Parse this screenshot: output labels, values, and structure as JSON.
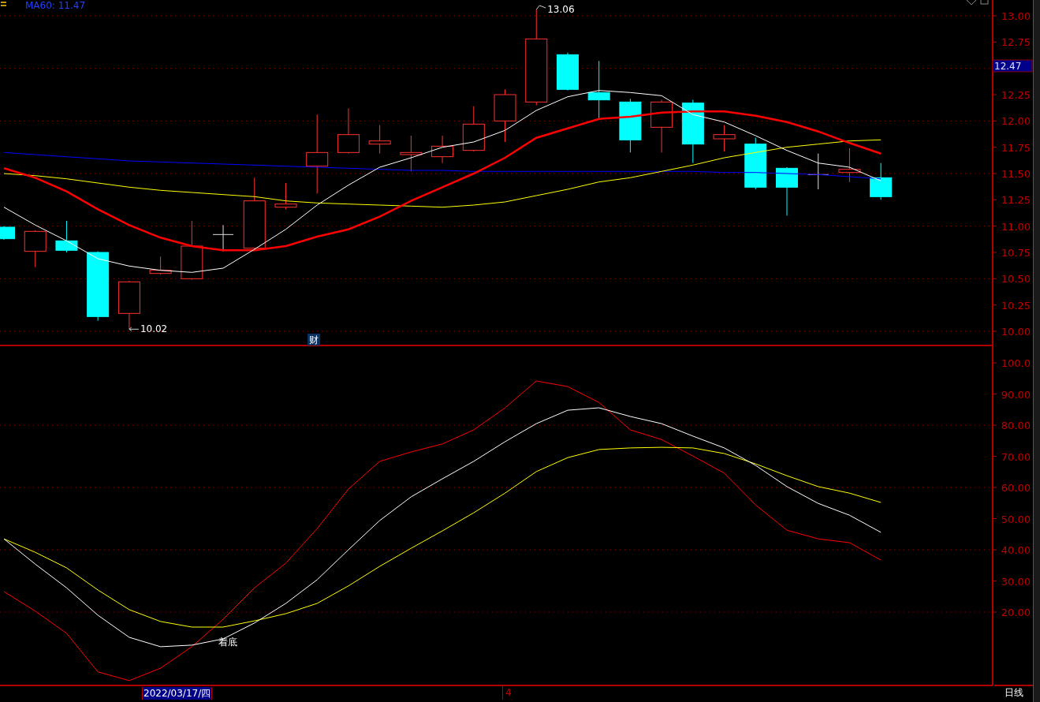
{
  "header": {
    "indicator": "MA60: 11.47"
  },
  "price_panel": {
    "current_price": "12.47",
    "event_marker": "财",
    "chart_data": {
      "type": "line",
      "grid": true,
      "ylim": [
        9.865,
        13.15
      ],
      "yticks": [
        {
          "value": 13,
          "label": "13.00"
        },
        {
          "value": 12.75,
          "label": "12.75"
        },
        {
          "value": 12.25,
          "label": "12.25"
        },
        {
          "value": 12,
          "label": "12.00"
        },
        {
          "value": 11.75,
          "label": "11.75"
        },
        {
          "value": 11.5,
          "label": "11.50"
        },
        {
          "value": 11.25,
          "label": "11.25"
        },
        {
          "value": 11,
          "label": "11.00"
        },
        {
          "value": 10.75,
          "label": "10.75"
        },
        {
          "value": 10.5,
          "label": "10.50"
        },
        {
          "value": 10.25,
          "label": "10.25"
        },
        {
          "value": 10,
          "label": "10.00"
        }
      ],
      "series": [
        {
          "color": "#0000ff",
          "values": [
            11.7,
            11.68,
            11.66,
            11.64,
            11.62,
            11.61,
            11.6,
            11.59,
            11.58,
            11.57,
            11.56,
            11.55,
            11.54,
            11.53,
            11.53,
            11.52,
            11.52,
            11.52,
            11.52,
            11.52,
            11.52,
            11.52,
            11.52,
            11.51,
            11.51,
            11.5,
            11.49,
            11.47,
            11.45
          ]
        },
        {
          "color": "#ffff00",
          "values": [
            11.5,
            11.48,
            11.45,
            11.41,
            11.37,
            11.34,
            11.32,
            11.3,
            11.28,
            11.24,
            11.22,
            11.21,
            11.2,
            11.19,
            11.18,
            11.2,
            11.23,
            11.29,
            11.35,
            11.42,
            11.46,
            11.52,
            11.58,
            11.65,
            11.7,
            11.75,
            11.78,
            11.81,
            11.82
          ]
        },
        {
          "color": "#ff0000",
          "values": [
            11.55,
            11.46,
            11.33,
            11.16,
            11.01,
            10.89,
            10.81,
            10.77,
            10.77,
            10.81,
            10.9,
            10.97,
            11.09,
            11.24,
            11.37,
            11.5,
            11.65,
            11.84,
            11.93,
            12.02,
            12.04,
            12.08,
            12.09,
            12.09,
            12.05,
            11.99,
            11.9,
            11.79,
            11.69
          ]
        },
        {
          "color": "#ffffff",
          "values": [
            11.18,
            11.01,
            10.86,
            10.69,
            10.62,
            10.58,
            10.56,
            10.6,
            10.78,
            10.97,
            11.2,
            11.39,
            11.56,
            11.65,
            11.75,
            11.8,
            11.91,
            12.1,
            12.23,
            12.29,
            12.27,
            12.24,
            12.06,
            11.99,
            11.86,
            11.72,
            11.6,
            11.56,
            11.43
          ]
        }
      ],
      "annotations": [
        "13.06",
        "10.02"
      ]
    }
  },
  "indicator_panel": {
    "signal_label": "着底",
    "chart_data": {
      "type": "line",
      "grid": true,
      "ylim": [
        -3.8,
        105.6
      ],
      "yticks": [
        {
          "value": 100,
          "label": "100.0"
        },
        {
          "value": 90,
          "label": "90.00"
        },
        {
          "value": 80,
          "label": "80.00"
        },
        {
          "value": 70,
          "label": "70.00"
        },
        {
          "value": 60,
          "label": "60.00"
        },
        {
          "value": 50,
          "label": "50.00"
        },
        {
          "value": 40,
          "label": "40.00"
        },
        {
          "value": 30,
          "label": "30.00"
        },
        {
          "value": 20,
          "label": "20.00"
        }
      ],
      "series": [
        {
          "color": "#ff0000",
          "values": [
            26.6,
            20.3,
            13.2,
            0.8,
            -2,
            2,
            8.9,
            17.7,
            27.8,
            35.7,
            46.8,
            59.5,
            68.4,
            71.4,
            74,
            78.5,
            85.6,
            94.2,
            92.4,
            87.3,
            78.5,
            75.4,
            70.1,
            64.6,
            54.4,
            46.3,
            43.5,
            42.3,
            36.7
          ]
        },
        {
          "color": "#ffff00",
          "values": [
            43.5,
            39.2,
            34.2,
            27.1,
            20.8,
            17,
            15.2,
            15.2,
            17.2,
            19.5,
            22.8,
            28.4,
            34.7,
            40.5,
            46.1,
            51.9,
            58.2,
            65.1,
            69.6,
            72.2,
            72.7,
            72.9,
            72.7,
            70.9,
            67.6,
            63.8,
            60.3,
            58.2,
            55.2
          ]
        },
        {
          "color": "#ffffff",
          "values": [
            43.5,
            35.4,
            27.8,
            19,
            11.9,
            8.9,
            9.4,
            11.4,
            16.5,
            22.8,
            30.4,
            40,
            49.4,
            57,
            62.8,
            68.4,
            74.7,
            80.5,
            84.8,
            85.6,
            82.8,
            80.5,
            76.5,
            72.7,
            67.1,
            60.3,
            54.9,
            51.1,
            45.6
          ]
        }
      ]
    }
  },
  "time_axis": {
    "date_label": "2022/03/17/四",
    "month_label": "4"
  },
  "period": "日线"
}
